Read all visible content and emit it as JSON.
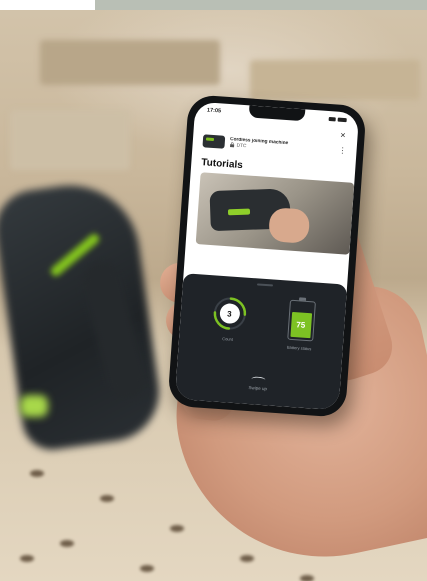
{
  "phone": {
    "status": {
      "time": "17:05"
    },
    "close_glyph": "×",
    "device": {
      "name": "Cordless joining machine",
      "model": "DTC",
      "menu_glyph": "⋮"
    },
    "tutorials_title": "Tutorials",
    "widgets": {
      "counter": {
        "value": "3",
        "label": "Count"
      },
      "battery": {
        "value": "75",
        "level_percent": 75,
        "label": "Battery status"
      }
    },
    "action_label": "Swipe up"
  },
  "colors": {
    "accent_green": "#7dc223",
    "panel_dark": "#1f2328",
    "phone_frame": "#111315"
  },
  "icons": [
    "close-icon",
    "menu-dots-icon",
    "battery-icon",
    "counter-ring-icon",
    "chevron-up-icon",
    "lock-icon"
  ]
}
